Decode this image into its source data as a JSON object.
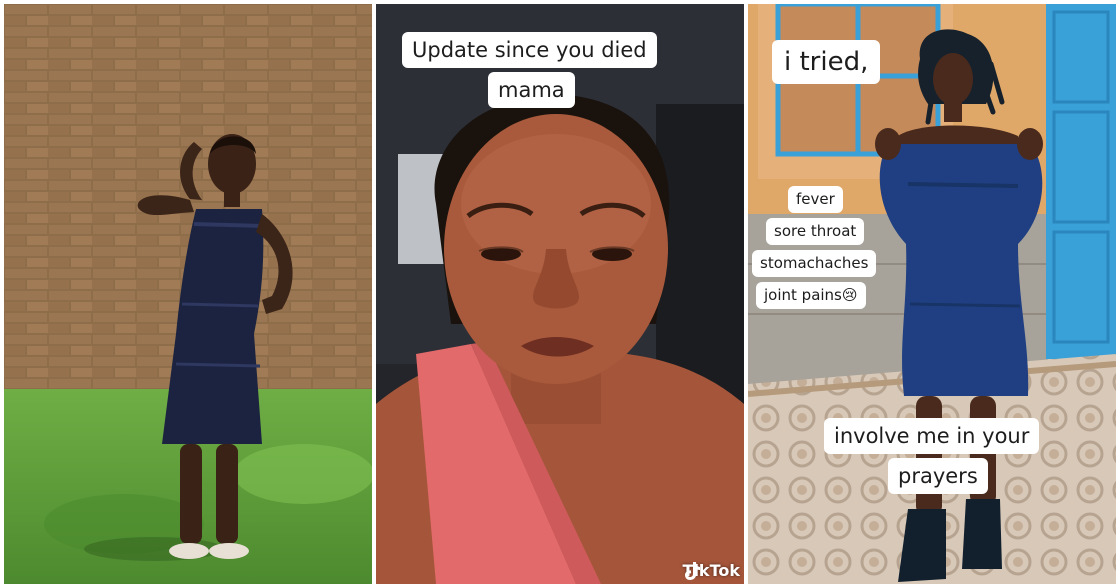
{
  "panels": [
    {
      "name": "brick-wall-photo",
      "captions": []
    },
    {
      "name": "selfie-photo",
      "captions": [
        {
          "line1": "Update since you died",
          "line2": "mama"
        }
      ],
      "watermark": "TikTok",
      "watermark_icon": "tiktok-logo-icon"
    },
    {
      "name": "blue-door-photo",
      "caption_top": "i tried,",
      "symptoms": [
        "fever",
        "sore throat",
        "stomachaches",
        "joint pains😢"
      ],
      "caption_bottom": {
        "line1": "involve me in your",
        "line2": "prayers"
      }
    }
  ],
  "colors": {
    "brick": "#8a6a48",
    "grass": "#5c9a3a",
    "dress": "#1b2340",
    "top_pink": "#e26a6a",
    "door_blue": "#3aa0d8",
    "caption_bg": "#ffffff"
  }
}
